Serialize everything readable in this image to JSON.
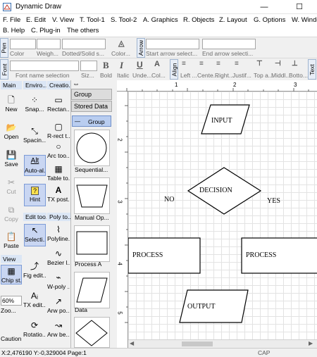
{
  "window": {
    "title": "Dynamic Draw",
    "minimize": "—",
    "maximize": "☐"
  },
  "menu": [
    "F. File",
    "E. Edit",
    "V. View",
    "T. Tool-1",
    "S. Tool-2",
    "A. Graphics",
    "R. Objects",
    "Z. Layout",
    "G. Options",
    "W. Window",
    "B. Help",
    "C. Plug-in",
    "The others"
  ],
  "tabs": {
    "pen": "Pen",
    "arrow": "Arrow",
    "font": "Font",
    "align": "Align",
    "text": "Text"
  },
  "pen_row": {
    "color": "Color",
    "weight": "Weigh...",
    "style": "Dotted/Solid s...",
    "fill_color": "Color...",
    "start_arrow": "Start arrow select...",
    "end_arrow": "End arrow selecti..."
  },
  "font_row": {
    "font_name": "Font name selection",
    "size": "Siz...",
    "bold": "Bold",
    "italic": "Italic",
    "underline": "Unde...",
    "color": "Col...",
    "left": "Left ...",
    "center": "Cente...",
    "right": "Right...",
    "justify": "Justif...",
    "top": "Top a...",
    "middle": "Middl...",
    "bottom": "Botto..."
  },
  "col_main": {
    "header": "Main",
    "new": "New",
    "open": "Open",
    "save": "Save",
    "cut": "Cut",
    "copy": "Copy",
    "paste": "Paste",
    "view": "View",
    "chip": "Chip st...",
    "zoom": "60%",
    "zoom_label": "Zoo...",
    "caution": "Caution"
  },
  "col_env": {
    "header": "Enviro...",
    "snap": "Snap...",
    "spacing": "Spacin...",
    "auto": "Auto-al...",
    "hint": "Hint",
    "edit_header": "Edit too...",
    "select": "Selecti...",
    "fig_edit": "Fig edit...",
    "tx_edit": "TX edit...",
    "rotation": "Rotatio..."
  },
  "col_create": {
    "header": "Creatio...",
    "rect": "Rectan...",
    "rrect": "R-rect t...",
    "arc": "Arc too...",
    "table": "Table to...",
    "tx": "TX post...",
    "poly_header": "Poly to...",
    "polyline": "Polyline...",
    "bezier": "Bezier l...",
    "wpoly": "W-poly ...",
    "arw_po": "Arw po...",
    "arw_be": "Arw be..."
  },
  "stencil": {
    "group": "Group",
    "stored": "Stored Data",
    "group_sel": "Group",
    "shapes": [
      "Sequential...",
      "Manual Op...",
      "Process A",
      "Data"
    ]
  },
  "ruler": {
    "top": [
      "1",
      "2",
      "3"
    ],
    "left": [
      "2",
      "3",
      "4",
      "5"
    ]
  },
  "diagram": {
    "input": "INPUT",
    "decision": "DECISION",
    "no": "NO",
    "yes": "YES",
    "process_left": "PROCESS",
    "process_right": "PROCESS",
    "output": "OUTPUT"
  },
  "status": {
    "coords": "X:2,476190 Y:-0,329004 Page:1",
    "cap": "CAP"
  }
}
